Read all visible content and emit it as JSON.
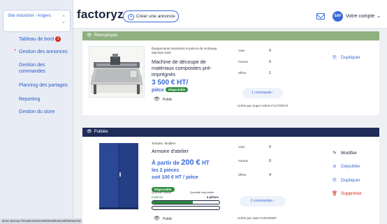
{
  "sidebar": {
    "site_label": "Site industriel - Angers",
    "items": [
      {
        "label": "Tableau de bord",
        "badge": "2"
      },
      {
        "label": "Gestion des annonces",
        "active": true
      },
      {
        "label": "Gestion des commandes"
      },
      {
        "label": "Planning des partages"
      },
      {
        "label": "Reporting"
      },
      {
        "label": "Gestion du store"
      }
    ]
  },
  "status_url": "demo.factoryz.fr/market/adverts/65fe6408e92448f2/80ad7dd",
  "header": {
    "logo": "factoryz",
    "create_label": "Créer une annonce",
    "avatar_initials": "SAF",
    "account_label": "Votre compte"
  },
  "colors": {
    "brand_blue": "#3a6ad8",
    "reemployee_green": "#8fb07f",
    "published_navy": "#1f2c58",
    "negotiable_green": "#2e8b3d",
    "danger_red": "#d6291f"
  },
  "cards": [
    {
      "status": "Réemployée",
      "category": "Équipements industriels et pièces de rechange, Machine Outil",
      "title": "Machine de découpe de matériaux composites pré-imprégnés",
      "price_main": "3 500 € HT/",
      "price_unit": "pièce",
      "negotiable": "Négociable",
      "visibility": "Public",
      "stats": [
        {
          "label": "Vues",
          "value": "0"
        },
        {
          "label": "Favoris",
          "value": "0"
        },
        {
          "label": "Offres",
          "value": "1"
        }
      ],
      "orders_label": "1 commande  ›",
      "creator": "Créée par Super Admin FACTORYZ",
      "actions": [
        {
          "label": "Dupliquer",
          "icon": "copy-icon"
        }
      ]
    },
    {
      "status": "Publiée",
      "category": "Tertiaire, Mobilier",
      "title": "Armoire d'atelier",
      "price_prefix": "À partir de ",
      "price_amount": "200 €",
      "price_suffix": " HT",
      "price_line2": "les 2 pièces",
      "price_line3": "soit 100 € HT / pièce",
      "negotiable": "Négociable",
      "qty_taken_label": "Quantité reprise",
      "qty_taken": "6 pièces",
      "qty_available_label": "Quantité disponible",
      "qty_available": "4 pièces",
      "progress_fraction": 0.6,
      "visibility": "Public",
      "stats": [
        {
          "label": "Vues",
          "value": "0"
        },
        {
          "label": "Favoris",
          "value": "0"
        },
        {
          "label": "Offres",
          "value": "4"
        }
      ],
      "orders_label": "2 commandes  ›",
      "creator": "Créée par Jean GUIGONET",
      "actions": [
        {
          "label": "Modifier",
          "icon": "edit-icon"
        },
        {
          "label": "Dépublier",
          "icon": "unpublish-icon"
        },
        {
          "label": "Dupliquer",
          "icon": "copy-icon"
        },
        {
          "label": "Supprimer",
          "icon": "trash-icon"
        }
      ]
    }
  ]
}
